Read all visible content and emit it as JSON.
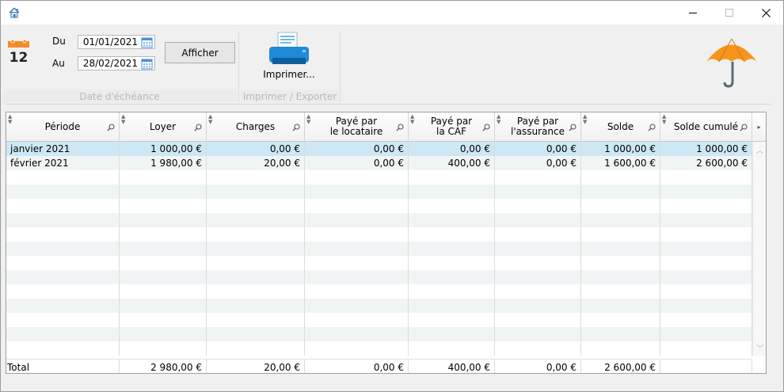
{
  "titlebar": {
    "app_icon": "home-icon",
    "minimize_icon": "minimize-icon",
    "maximize_icon": "maximize-icon",
    "close_icon": "close-icon"
  },
  "ribbon": {
    "calendar_icon": "calendar-icon",
    "calendar_day": "12",
    "from_label": "Du",
    "from_value": "01/01/2021",
    "to_label": "Au",
    "to_value": "28/02/2021",
    "afficher_label": "Afficher",
    "group_date_label": "Date d'échéance",
    "print_label": "Imprimer...",
    "group_print_label": "Imprimer / Exporter",
    "umbrella_icon": "umbrella-icon",
    "colors": {
      "calendar_orange": "#f28c28",
      "printer_blue": "#1f8ad6",
      "umbrella_orange": "#f7941d"
    }
  },
  "grid": {
    "columns": [
      {
        "label": "Période"
      },
      {
        "label": "Loyer"
      },
      {
        "label": "Charges"
      },
      {
        "label": "Payé par\nle locataire"
      },
      {
        "label": "Payé par\nla CAF"
      },
      {
        "label": "Payé par\nl'assurance"
      },
      {
        "label": "Solde"
      },
      {
        "label": "Solde cumulé"
      }
    ],
    "rows": [
      [
        "janvier 2021",
        "1 000,00 €",
        "0,00 €",
        "0,00 €",
        "0,00 €",
        "0,00 €",
        "1 000,00 €",
        "1 000,00 €"
      ],
      [
        "février 2021",
        "1 980,00 €",
        "20,00 €",
        "0,00 €",
        "400,00 €",
        "0,00 €",
        "1 600,00 €",
        "2 600,00 €"
      ]
    ],
    "total": [
      "Total",
      "2 980,00 €",
      "20,00 €",
      "0,00 €",
      "400,00 €",
      "0,00 €",
      "2 600,00 €",
      ""
    ],
    "selected_row_color": "#cce8f4",
    "alt_row_color": "#f1f4f4"
  }
}
